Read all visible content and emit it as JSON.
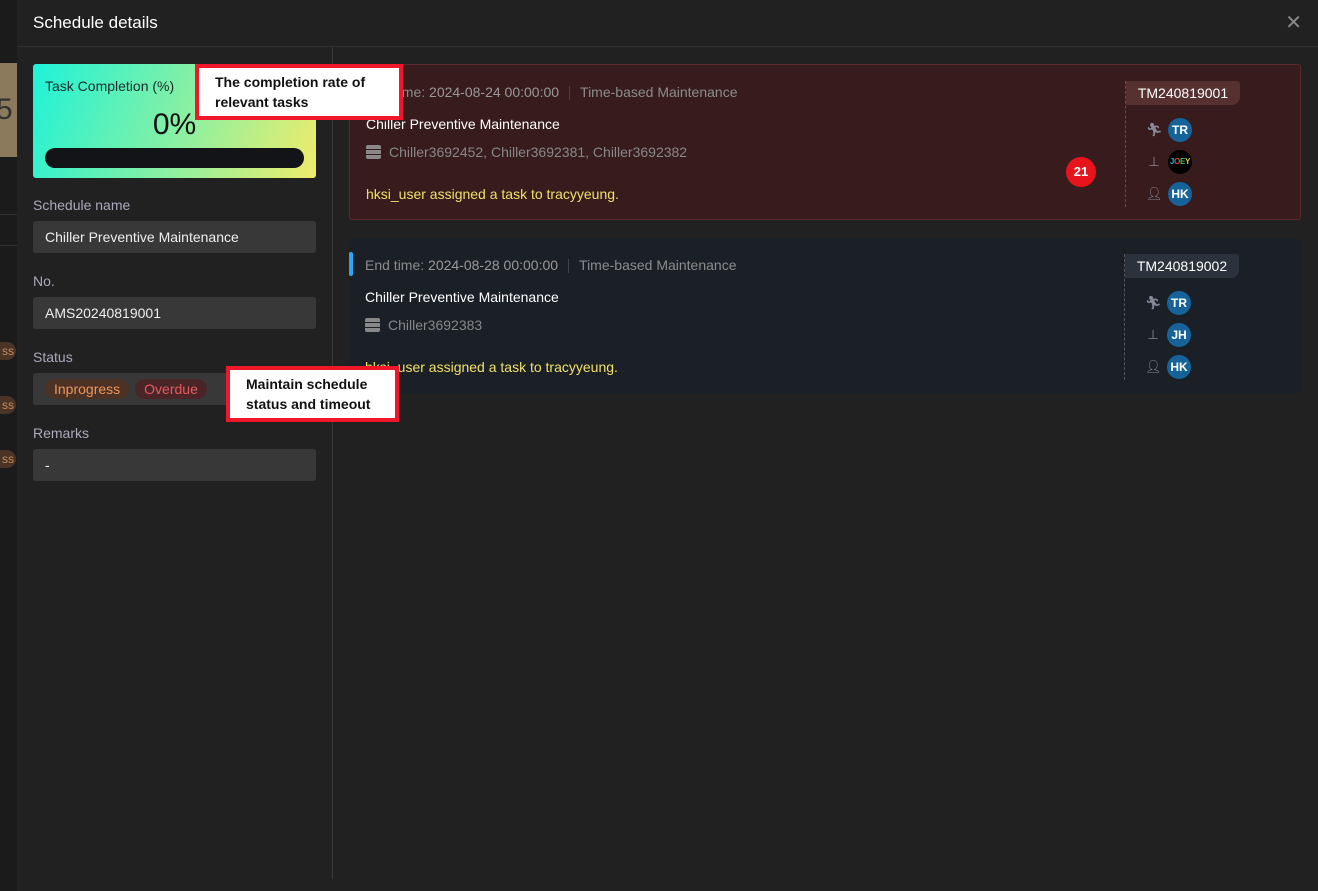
{
  "background": {
    "digit": "5",
    "badge_fragment": "ss"
  },
  "header": {
    "title": "Schedule details",
    "close_icon": "close-icon"
  },
  "completion": {
    "label": "Task Completion (%)",
    "value_text": "0%",
    "progress": 0
  },
  "fields": {
    "schedule_name": {
      "label": "Schedule name",
      "value": "Chiller Preventive Maintenance"
    },
    "no": {
      "label": "No.",
      "value": "AMS20240819001"
    },
    "status": {
      "label": "Status",
      "badges": [
        "Inprogress",
        "Overdue"
      ]
    },
    "remarks": {
      "label": "Remarks",
      "value": "-"
    }
  },
  "annotations": {
    "completion": "The completion rate of relevant tasks",
    "status": "Maintain schedule status and timeout"
  },
  "tasks": [
    {
      "end_label": "End time:",
      "end_time": "2024-08-24 00:00:00",
      "type": "Time-based Maintenance",
      "name": "Chiller Preventive Maintenance",
      "devices": "Chiller3692452, Chiller3692381, Chiller3692382",
      "message": "hksi_user assigned a task to tracyyeung.",
      "count": "21",
      "code": "TM240819001",
      "people": [
        "TR",
        "JOEY",
        "HK"
      ],
      "color": "#371b1d"
    },
    {
      "end_label": "End time:",
      "end_time": "2024-08-28 00:00:00",
      "type": "Time-based Maintenance",
      "name": "Chiller Preventive Maintenance",
      "devices": "Chiller3692383",
      "message": "hksi_user assigned a task to tracyyeung.",
      "code": "TM240819002",
      "people": [
        "TR",
        "JH",
        "HK"
      ],
      "color": "#1b1f26"
    }
  ]
}
